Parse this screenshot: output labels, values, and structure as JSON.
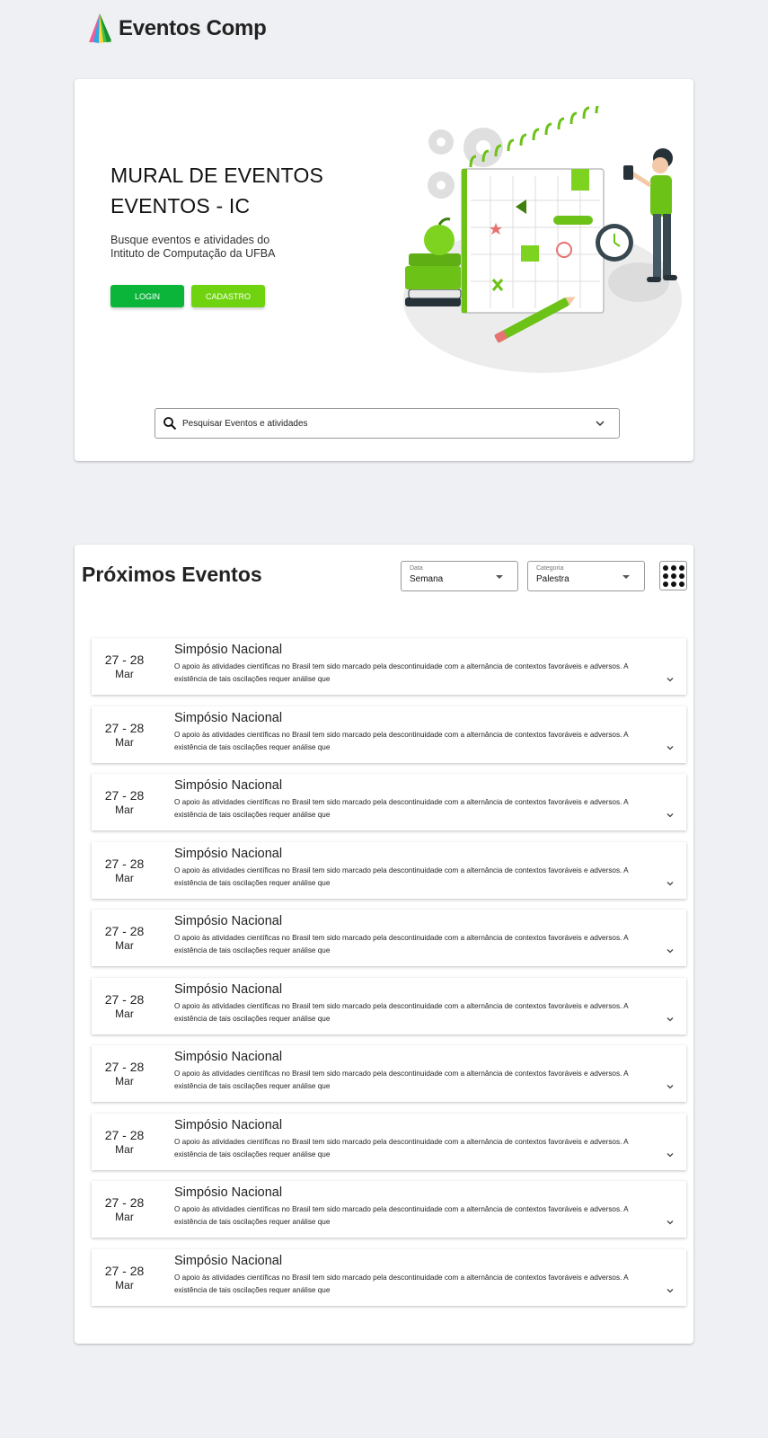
{
  "header": {
    "brand": "Eventos Comp"
  },
  "hero": {
    "title_line1": "MURAL DE EVENTOS",
    "title_line2": "EVENTOS - IC",
    "subtitle_line1": "Busque eventos e atividades do",
    "subtitle_line2": "Intituto de Computação da UFBA",
    "login_label": "LOGIN",
    "cadastro_label": "CADASTRO",
    "search_placeholder": "Pesquisar Eventos e atividades"
  },
  "events_section": {
    "title": "Próximos Eventos",
    "filter_data": {
      "label": "Data",
      "value": "Semana"
    },
    "filter_categoria": {
      "label": "Categoria",
      "value": "Palestra"
    },
    "events": [
      {
        "date": "27 - 28",
        "month": "Mar",
        "title": "Simpósio Nacional",
        "description": "O apoio às atividades científicas no Brasil tem sido marcado pela descontinuidade com a alternância de contextos favoráveis e adversos. A existência de tais oscilações requer análise que"
      },
      {
        "date": "27 - 28",
        "month": "Mar",
        "title": "Simpósio Nacional",
        "description": "O apoio às atividades científicas no Brasil tem sido marcado pela descontinuidade com a alternância de contextos favoráveis e adversos. A existência de tais oscilações requer análise que"
      },
      {
        "date": "27 - 28",
        "month": "Mar",
        "title": "Simpósio Nacional",
        "description": "O apoio às atividades científicas no Brasil tem sido marcado pela descontinuidade com a alternância de contextos favoráveis e adversos. A existência de tais oscilações requer análise que"
      },
      {
        "date": "27 - 28",
        "month": "Mar",
        "title": "Simpósio Nacional",
        "description": "O apoio às atividades científicas no Brasil tem sido marcado pela descontinuidade com a alternância de contextos favoráveis e adversos. A existência de tais oscilações requer análise que"
      },
      {
        "date": "27 - 28",
        "month": "Mar",
        "title": "Simpósio Nacional",
        "description": "O apoio às atividades científicas no Brasil tem sido marcado pela descontinuidade com a alternância de contextos favoráveis e adversos. A existência de tais oscilações requer análise que"
      },
      {
        "date": "27 - 28",
        "month": "Mar",
        "title": "Simpósio Nacional",
        "description": "O apoio às atividades científicas no Brasil tem sido marcado pela descontinuidade com a alternância de contextos favoráveis e adversos. A existência de tais oscilações requer análise que"
      },
      {
        "date": "27 - 28",
        "month": "Mar",
        "title": "Simpósio Nacional",
        "description": "O apoio às atividades científicas no Brasil tem sido marcado pela descontinuidade com a alternância de contextos favoráveis e adversos. A existência de tais oscilações requer análise que"
      },
      {
        "date": "27 - 28",
        "month": "Mar",
        "title": "Simpósio Nacional",
        "description": "O apoio às atividades científicas no Brasil tem sido marcado pela descontinuidade com a alternância de contextos favoráveis e adversos. A existência de tais oscilações requer análise que"
      },
      {
        "date": "27 - 28",
        "month": "Mar",
        "title": "Simpósio Nacional",
        "description": "O apoio às atividades científicas no Brasil tem sido marcado pela descontinuidade com a alternância de contextos favoráveis e adversos. A existência de tais oscilações requer análise que"
      },
      {
        "date": "27 - 28",
        "month": "Mar",
        "title": "Simpósio Nacional",
        "description": "O apoio às atividades científicas no Brasil tem sido marcado pela descontinuidade com a alternância de contextos favoráveis e adversos. A existência de tais oscilações requer análise que"
      }
    ]
  },
  "colors": {
    "background": "#eff0f4",
    "primary_green": "#0bb53a",
    "accent_green": "#6fd30f",
    "card": "#ffffff"
  },
  "icons": {
    "logo": "eventos-comp-logo",
    "search": "search-icon",
    "dropdown": "chevron-down-icon",
    "grid": "grid-view-icon",
    "event_expand": "chevron-down-icon"
  }
}
